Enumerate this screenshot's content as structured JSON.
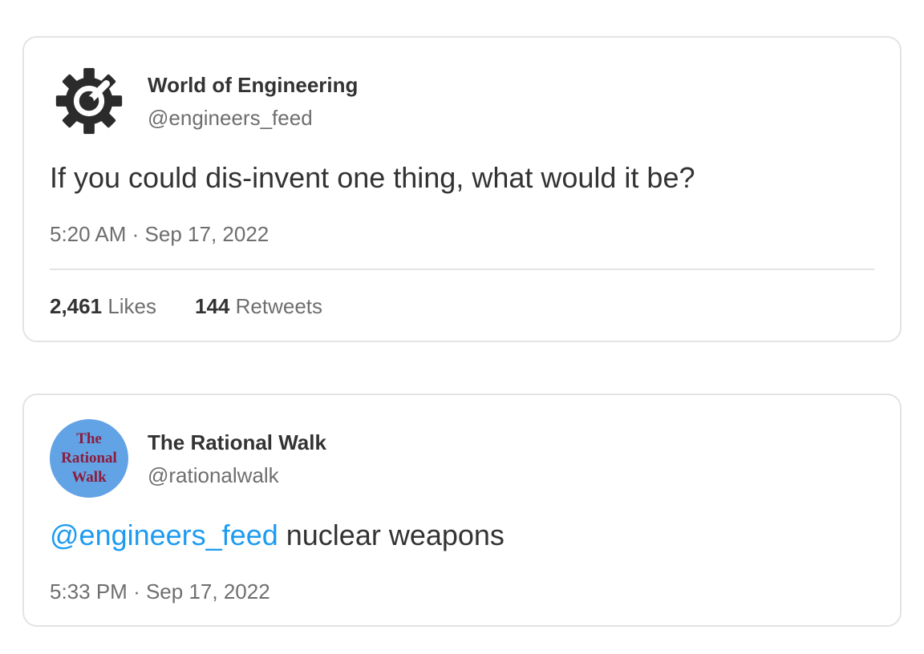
{
  "tweets": [
    {
      "avatar_icon": "gear-wrench-icon",
      "display_name": "World of Engineering",
      "handle": "@engineers_feed",
      "text": "If you could dis-invent one thing, what would it be?",
      "time": "5:20 AM",
      "separator": "·",
      "date": "Sep 17, 2022",
      "likes_count": "2,461",
      "likes_label": "Likes",
      "retweets_count": "144",
      "retweets_label": "Retweets"
    },
    {
      "avatar_text": [
        "The",
        "Rational",
        "Walk"
      ],
      "display_name": "The Rational Walk",
      "handle": "@rationalwalk",
      "mention": "@engineers_feed",
      "text": " nuclear weapons",
      "time": "5:33 PM",
      "separator": "·",
      "date": "Sep 17, 2022"
    }
  ],
  "colors": {
    "mention": "#1d9bf0",
    "avatar_blue": "#62a3e6",
    "avatar_text": "#8c1c3c",
    "border": "#e3e3e3"
  }
}
